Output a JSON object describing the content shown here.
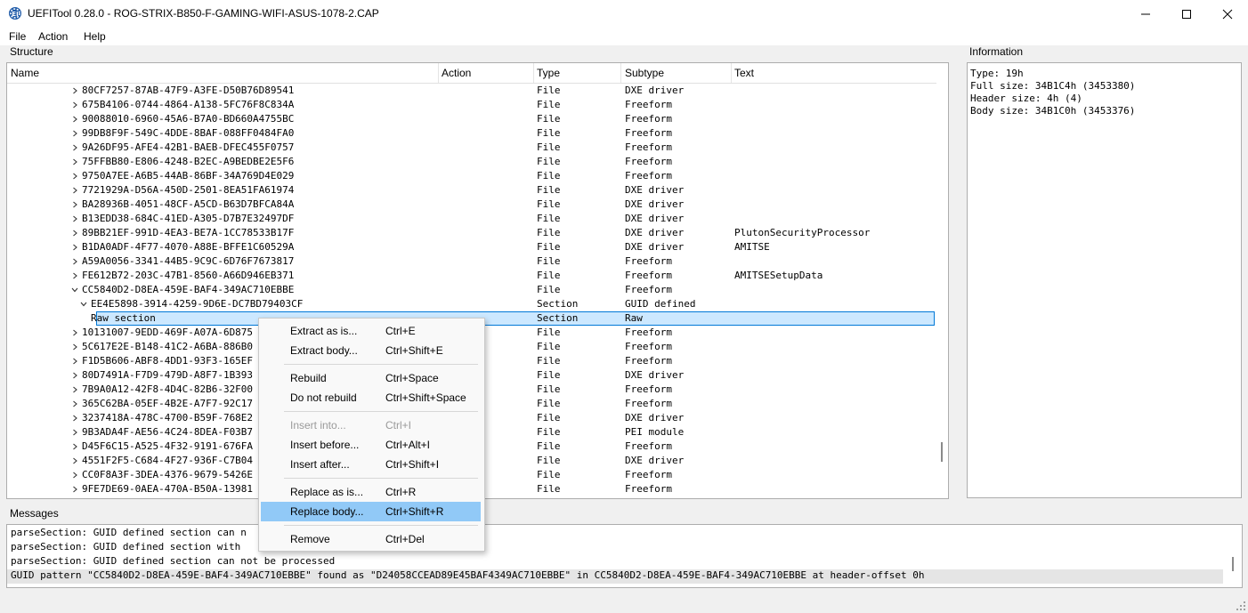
{
  "window": {
    "title": "UEFITool 0.28.0 - ROG-STRIX-B850-F-GAMING-WIFI-ASUS-1078-2.CAP",
    "icon": "uefitool-gear-icon",
    "accent": "#0078d7"
  },
  "menu": [
    {
      "label": "File"
    },
    {
      "label": "Action"
    },
    {
      "label": "Help"
    }
  ],
  "structure": {
    "label": "Structure",
    "columns": [
      "Name",
      "Action",
      "Type",
      "Subtype",
      "Text"
    ],
    "rows": [
      {
        "name": "80CF7257-87AB-47F9-A3FE-D50B76D89541",
        "type": "File",
        "subtype": "DXE driver",
        "text": "",
        "level": 0,
        "expander": "collapsed"
      },
      {
        "name": "675B4106-0744-4864-A138-5FC76F8C834A",
        "type": "File",
        "subtype": "Freeform",
        "text": "",
        "level": 0,
        "expander": "collapsed"
      },
      {
        "name": "90088010-6960-45A6-B7A0-BD660A4755BC",
        "type": "File",
        "subtype": "Freeform",
        "text": "",
        "level": 0,
        "expander": "collapsed"
      },
      {
        "name": "99DB8F9F-549C-4DDE-8BAF-088FF0484FA0",
        "type": "File",
        "subtype": "Freeform",
        "text": "",
        "level": 0,
        "expander": "collapsed"
      },
      {
        "name": "9A26DF95-AFE4-42B1-BAEB-DFEC455F0757",
        "type": "File",
        "subtype": "Freeform",
        "text": "",
        "level": 0,
        "expander": "collapsed"
      },
      {
        "name": "75FFBB80-E806-4248-B2EC-A9BEDBE2E5F6",
        "type": "File",
        "subtype": "Freeform",
        "text": "",
        "level": 0,
        "expander": "collapsed"
      },
      {
        "name": "9750A7EE-A6B5-44AB-86BF-34A769D4E029",
        "type": "File",
        "subtype": "Freeform",
        "text": "",
        "level": 0,
        "expander": "collapsed"
      },
      {
        "name": "7721929A-D56A-450D-2501-8EA51FA61974",
        "type": "File",
        "subtype": "DXE driver",
        "text": "",
        "level": 0,
        "expander": "collapsed"
      },
      {
        "name": "BA28936B-4051-48CF-A5CD-B63D7BFCA84A",
        "type": "File",
        "subtype": "DXE driver",
        "text": "",
        "level": 0,
        "expander": "collapsed"
      },
      {
        "name": "B13EDD38-684C-41ED-A305-D7B7E32497DF",
        "type": "File",
        "subtype": "DXE driver",
        "text": "",
        "level": 0,
        "expander": "collapsed"
      },
      {
        "name": "89BB21EF-991D-4EA3-BE7A-1CC78533B17F",
        "type": "File",
        "subtype": "DXE driver",
        "text": "PlutonSecurityProcessor",
        "level": 0,
        "expander": "collapsed"
      },
      {
        "name": "B1DA0ADF-4F77-4070-A88E-BFFE1C60529A",
        "type": "File",
        "subtype": "DXE driver",
        "text": "AMITSE",
        "level": 0,
        "expander": "collapsed"
      },
      {
        "name": "A59A0056-3341-44B5-9C9C-6D76F7673817",
        "type": "File",
        "subtype": "Freeform",
        "text": "",
        "level": 0,
        "expander": "collapsed"
      },
      {
        "name": "FE612B72-203C-47B1-8560-A66D946EB371",
        "type": "File",
        "subtype": "Freeform",
        "text": "AMITSESetupData",
        "level": 0,
        "expander": "collapsed"
      },
      {
        "name": "CC5840D2-D8EA-459E-BAF4-349AC710EBBE",
        "type": "File",
        "subtype": "Freeform",
        "text": "",
        "level": 0,
        "expander": "expanded"
      },
      {
        "name": "EE4E5898-3914-4259-9D6E-DC7BD79403CF",
        "type": "Section",
        "subtype": "GUID defined",
        "text": "",
        "level": 1,
        "expander": "expanded"
      },
      {
        "name": "Raw section",
        "type": "Section",
        "subtype": "Raw",
        "text": "",
        "level": 2,
        "expander": "none",
        "selected": true
      },
      {
        "name": "10131007-9EDD-469F-A07A-6D875",
        "type": "File",
        "subtype": "Freeform",
        "text": "",
        "level": 0,
        "expander": "collapsed"
      },
      {
        "name": "5C617E2E-B148-41C2-A6BA-886B0",
        "type": "File",
        "subtype": "Freeform",
        "text": "",
        "level": 0,
        "expander": "collapsed"
      },
      {
        "name": "F1D5B606-ABF8-4DD1-93F3-165EF",
        "type": "File",
        "subtype": "Freeform",
        "text": "",
        "level": 0,
        "expander": "collapsed"
      },
      {
        "name": "80D7491A-F7D9-479D-A8F7-1B393",
        "type": "File",
        "subtype": "DXE driver",
        "text": "",
        "level": 0,
        "expander": "collapsed"
      },
      {
        "name": "7B9A0A12-42F8-4D4C-82B6-32F00",
        "type": "File",
        "subtype": "Freeform",
        "text": "",
        "level": 0,
        "expander": "collapsed"
      },
      {
        "name": "365C62BA-05EF-4B2E-A7F7-92C17",
        "type": "File",
        "subtype": "Freeform",
        "text": "",
        "level": 0,
        "expander": "collapsed"
      },
      {
        "name": "3237418A-478C-4700-B59F-768E2",
        "type": "File",
        "subtype": "DXE driver",
        "text": "",
        "level": 0,
        "expander": "collapsed"
      },
      {
        "name": "9B3ADA4F-AE56-4C24-8DEA-F03B7",
        "type": "File",
        "subtype": "PEI module",
        "text": "",
        "level": 0,
        "expander": "collapsed"
      },
      {
        "name": "D45F6C15-A525-4F32-9191-676FA",
        "type": "File",
        "subtype": "Freeform",
        "text": "",
        "level": 0,
        "expander": "collapsed"
      },
      {
        "name": "4551F2F5-C684-4F27-936F-C7B04",
        "type": "File",
        "subtype": "DXE driver",
        "text": "",
        "level": 0,
        "expander": "collapsed"
      },
      {
        "name": "CC0F8A3F-3DEA-4376-9679-5426E",
        "type": "File",
        "subtype": "Freeform",
        "text": "",
        "level": 0,
        "expander": "collapsed"
      },
      {
        "name": "9FE7DE69-0AEA-470A-B50A-13981",
        "type": "File",
        "subtype": "Freeform",
        "text": "",
        "level": 0,
        "expander": "collapsed"
      }
    ]
  },
  "information": {
    "label": "Information",
    "lines": [
      "Type: 19h",
      "Full size: 34B1C4h (3453380)",
      "Header size: 4h (4)",
      "Body size: 34B1C0h (3453376)"
    ]
  },
  "messages": {
    "label": "Messages",
    "lines": [
      "parseSection: GUID defined section can n",
      "parseSection: GUID defined section with",
      "parseSection: GUID defined section can not be processed",
      "GUID pattern \"CC5840D2-D8EA-459E-BAF4-349AC710EBBE\" found as \"D24058CCEAD89E45BAF4349AC710EBBE\" in CC5840D2-D8EA-459E-BAF4-349AC710EBBE at header-offset 0h"
    ],
    "selected_index": 3
  },
  "context_menu": {
    "groups": [
      [
        {
          "label": "Extract as is...",
          "shortcut": "Ctrl+E",
          "enabled": true
        },
        {
          "label": "Extract body...",
          "shortcut": "Ctrl+Shift+E",
          "enabled": true
        }
      ],
      [
        {
          "label": "Rebuild",
          "shortcut": "Ctrl+Space",
          "enabled": true
        },
        {
          "label": "Do not rebuild",
          "shortcut": "Ctrl+Shift+Space",
          "enabled": true
        }
      ],
      [
        {
          "label": "Insert into...",
          "shortcut": "Ctrl+I",
          "enabled": false
        },
        {
          "label": "Insert before...",
          "shortcut": "Ctrl+Alt+I",
          "enabled": true
        },
        {
          "label": "Insert after...",
          "shortcut": "Ctrl+Shift+I",
          "enabled": true
        }
      ],
      [
        {
          "label": "Replace as is...",
          "shortcut": "Ctrl+R",
          "enabled": true
        },
        {
          "label": "Replace body...",
          "shortcut": "Ctrl+Shift+R",
          "enabled": true,
          "hovered": true
        }
      ],
      [
        {
          "label": "Remove",
          "shortcut": "Ctrl+Del",
          "enabled": true
        }
      ]
    ]
  }
}
